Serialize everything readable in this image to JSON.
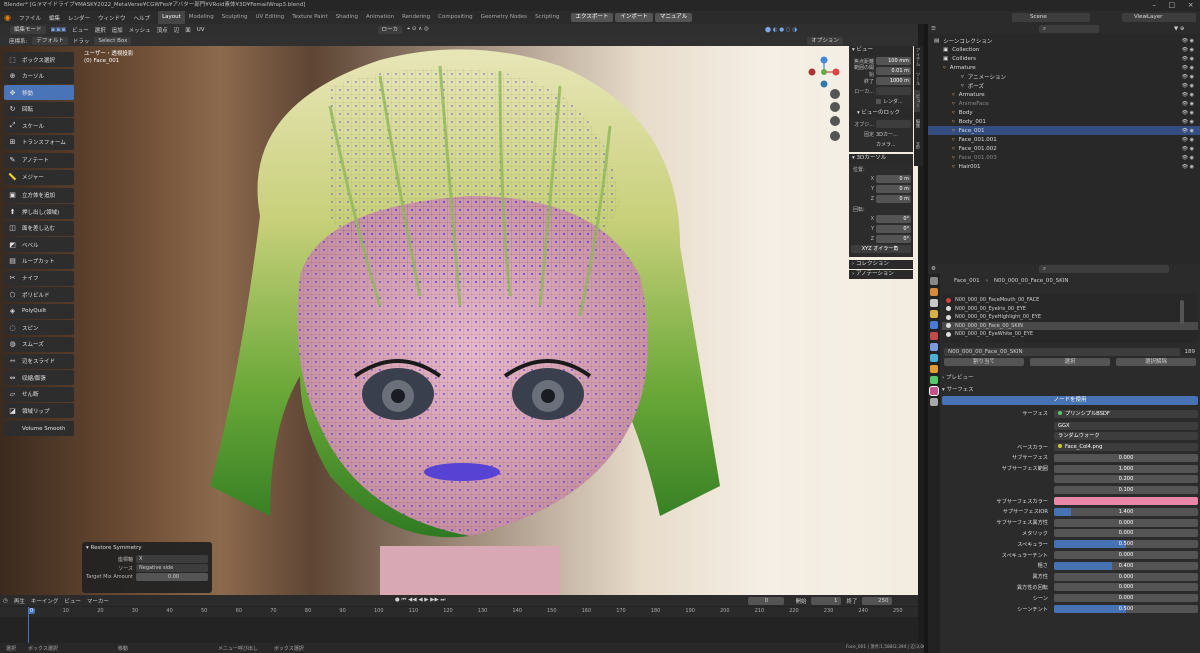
{
  "title": "Blender* [G:¥マイドライブ¥MASK¥2022_MetaVerse¥CGWFes¥アバター部門¥VRoid素体¥3D¥FemailWrap3.blend]",
  "menus": [
    "ファイル",
    "編集",
    "レンダー",
    "ウィンドウ",
    "ヘルプ"
  ],
  "workspaces": [
    "Layout",
    "Modeling",
    "Sculpting",
    "UV Editing",
    "Texture Paint",
    "Shading",
    "Animation",
    "Rendering",
    "Compositing",
    "Geometry Nodes",
    "Scripting"
  ],
  "top_buttons": [
    "エクスポート",
    "インポート",
    "マニュアル"
  ],
  "scene": "Scene",
  "view_layer": "ViewLayer",
  "header": {
    "mode": "編集モード",
    "view": "ビュー",
    "select": "選択",
    "add": "追加",
    "mesh": "メッシュ",
    "vertex": "頂点",
    "edge": "辺",
    "face": "面",
    "uv": "UV",
    "transform": "ローカ",
    "options": "オプション"
  },
  "tool_settings": {
    "orient_label": "座標系:",
    "orient_value": "デフォルト",
    "drag_label": "ドラッ",
    "select_box": "Select Box"
  },
  "viewport": {
    "line1": "ユーザー・透視投影",
    "line2": "(0) Face_001"
  },
  "tools": [
    {
      "label": "ボックス選択",
      "icon": "⬚"
    },
    {
      "label": "カーソル",
      "icon": "⊕"
    },
    {
      "label": "移動",
      "icon": "✥",
      "active": true
    },
    {
      "label": "回転",
      "icon": "↻"
    },
    {
      "label": "スケール",
      "icon": "⤢"
    },
    {
      "label": "トランスフォーム",
      "icon": "⊞"
    },
    {
      "label": "アノテート",
      "icon": "✎"
    },
    {
      "label": "メジャー",
      "icon": "📏"
    },
    {
      "label": "立方体を追加",
      "icon": "▣"
    },
    {
      "label": "押し出し(領域)",
      "icon": "⬆"
    },
    {
      "label": "面を差し込む",
      "icon": "◫"
    },
    {
      "label": "ベベル",
      "icon": "◩"
    },
    {
      "label": "ループカット",
      "icon": "▤"
    },
    {
      "label": "ナイフ",
      "icon": "✂"
    },
    {
      "label": "ポリビルド",
      "icon": "⬡"
    },
    {
      "label": "PolyQuilt",
      "icon": "◈"
    },
    {
      "label": "スピン",
      "icon": "◌"
    },
    {
      "label": "スムーズ",
      "icon": "◍"
    },
    {
      "label": "辺をスライド",
      "icon": "⇿"
    },
    {
      "label": "収縮/膨張",
      "icon": "⇔"
    },
    {
      "label": "せん断",
      "icon": "▱"
    },
    {
      "label": "領域リップ",
      "icon": "◪"
    },
    {
      "label": "Volume Smooth",
      "icon": ""
    }
  ],
  "npanel": {
    "view_title": "ビュー",
    "focal_label": "焦点距離",
    "focal": "100 mm",
    "clip_label": "範囲の開始",
    "clip_start": "0.01 m",
    "end_label": "終了",
    "clip_end": "1000 m",
    "local_label": "ローカ...",
    "render_label": "レンダ...",
    "lock_title": "ビューのロック",
    "obj_label": "オブジ...",
    "fix_label": "固定",
    "cursor_3d_label": "3Dカー...",
    "camera_label": "カメラ...",
    "cursor_title": "3Dカーソル",
    "loc_label": "位置:",
    "x": "X",
    "y": "Y",
    "z": "Z",
    "loc_x": "0 m",
    "loc_y": "0 m",
    "loc_z": "0 m",
    "rot_label": "回転:",
    "rot_x": "0°",
    "rot_y": "0°",
    "rot_z": "0°",
    "euler": "XYZ オイラー角",
    "collection": "コレクション",
    "annotation": "アノテーション",
    "tabs": [
      "アイテム",
      "ツール",
      "ビュー",
      "編集",
      "MB"
    ]
  },
  "redo_panel": {
    "title": "Restore Symmetry",
    "axis_label": "座標軸",
    "axis": "X",
    "source_label": "ソース",
    "source": "Negative side",
    "mix_label": "Target Mix Amount",
    "mix": "0.00"
  },
  "timeline": {
    "playback": "再生",
    "keying": "キーイング",
    "view": "ビュー",
    "marker": "マーカー",
    "current": "0",
    "start_label": "開始",
    "start": "1",
    "end_label": "終了",
    "end": "250",
    "ticks": [
      "0",
      "10",
      "20",
      "30",
      "40",
      "50",
      "60",
      "70",
      "80",
      "90",
      "100",
      "110",
      "120",
      "130",
      "140",
      "150",
      "160",
      "170",
      "180",
      "190",
      "200",
      "210",
      "220",
      "230",
      "240",
      "250"
    ]
  },
  "status": {
    "select": "選択",
    "box_select": "ボックス選択",
    "move": "移動",
    "menu": "メニュー呼び出し",
    "box_select2": "ボックス選択",
    "stats": "Face_001 | 頂点:1,588/2,394 | 辺:3,063/4,382 | 面:1,472/2,186 | 三角面:4,228 | オブジェクト:1/7 | メモリ:875.6 MiB | VRAM:8.0/10.0 GiB | 3.0.0"
  },
  "outliner": {
    "rows": [
      {
        "label": "シーンコレクション",
        "indent": 0
      },
      {
        "label": "Collection",
        "indent": 1
      },
      {
        "label": "Colliders",
        "indent": 1
      },
      {
        "label": "Armature",
        "indent": 1,
        "color": "#e3a35a"
      },
      {
        "label": "アニメーション",
        "indent": 3
      },
      {
        "label": "ポーズ",
        "indent": 3
      },
      {
        "label": "Armature",
        "indent": 2,
        "color": "#e3a35a"
      },
      {
        "label": "AnimeFace",
        "indent": 2,
        "color": "#e3a35a",
        "dim": true
      },
      {
        "label": "Body",
        "indent": 2,
        "color": "#e3a35a"
      },
      {
        "label": "Body_001",
        "indent": 2,
        "color": "#e3a35a"
      },
      {
        "label": "Face_001",
        "indent": 2,
        "color": "#e3a35a",
        "sel": true
      },
      {
        "label": "Face_001.001",
        "indent": 2,
        "color": "#e3a35a"
      },
      {
        "label": "Face_001.002",
        "indent": 2,
        "color": "#e3a35a"
      },
      {
        "label": "Face_001.003",
        "indent": 2,
        "color": "#e3a35a",
        "dim": true
      },
      {
        "label": "Hair001",
        "indent": 2,
        "color": "#e3a35a"
      }
    ]
  },
  "properties": {
    "breadcrumb_obj": "Face_001",
    "breadcrumb_mat": "N00_000_00_Face_00_SKIN",
    "materials": [
      "N00_000_00_FaceMouth_00_FACE",
      "N00_000_00_EyeIris_00_EYE",
      "N00_000_00_EyeHighlight_00_EYE",
      "N00_000_00_Face_00_SKIN",
      "N00_000_00_EyeWhite_00_EYE"
    ],
    "active_material": "N00_000_00_Face_00_SKIN",
    "users": "189",
    "assign": "割り当て",
    "select": "選択",
    "deselect": "選択解除",
    "preview": "プレビュー",
    "surface_section": "サーフェス",
    "use_nodes": "ノードを使用",
    "surface_label": "サーフェス",
    "surface_value": "プリンシプルBSDF",
    "distribution": "GGX",
    "subsurface_method": "ランダムウォーク",
    "base_color_label": "ベースカラー",
    "base_color_tex": "Face_Col4.png",
    "props": [
      {
        "label": "サブサーフェス",
        "value": "0.000",
        "fill": 0
      },
      {
        "label": "サブサーフェス範囲",
        "value": "1.000",
        "fill": 0
      },
      {
        "label": "",
        "value": "0.200",
        "fill": 0
      },
      {
        "label": "",
        "value": "0.100",
        "fill": 0
      },
      {
        "label": "サブサーフェスカラー",
        "value": "",
        "color": "#e887a8"
      },
      {
        "label": "サブサーフェスIOR",
        "value": "1.400",
        "fill": 0.12
      },
      {
        "label": "サブサーフェス異方性",
        "value": "0.000",
        "fill": 0
      },
      {
        "label": "メタリック",
        "value": "0.000",
        "fill": 0
      },
      {
        "label": "スペキュラー",
        "value": "0.500",
        "fill": 0.5
      },
      {
        "label": "スペキュラーチント",
        "value": "0.000",
        "fill": 0
      },
      {
        "label": "粗さ",
        "value": "0.400",
        "fill": 0.4
      },
      {
        "label": "異方性",
        "value": "0.000",
        "fill": 0
      },
      {
        "label": "異方性の回転",
        "value": "0.000",
        "fill": 0
      },
      {
        "label": "シーン",
        "value": "0.000",
        "fill": 0
      },
      {
        "label": "シーンチント",
        "value": "0.500",
        "fill": 0.5
      }
    ]
  }
}
